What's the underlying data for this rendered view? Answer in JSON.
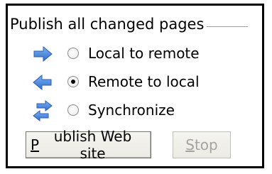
{
  "group": {
    "title": "Publish all changed pages"
  },
  "options": [
    {
      "label": "Local to remote",
      "icon": "arrow-right-icon",
      "selected": false
    },
    {
      "label": "Remote to local",
      "icon": "arrow-left-icon",
      "selected": true
    },
    {
      "label": "Synchronize",
      "icon": "sync-arrows-icon",
      "selected": false
    }
  ],
  "buttons": {
    "publish": {
      "mnemonic": "P",
      "rest": "ublish Web site"
    },
    "stop": {
      "mnemonic": "S",
      "rest": "top",
      "disabled": true
    }
  },
  "colors": {
    "arrow_blue": "#2f6fd0",
    "arrow_blue_light": "#7fb0f0"
  }
}
